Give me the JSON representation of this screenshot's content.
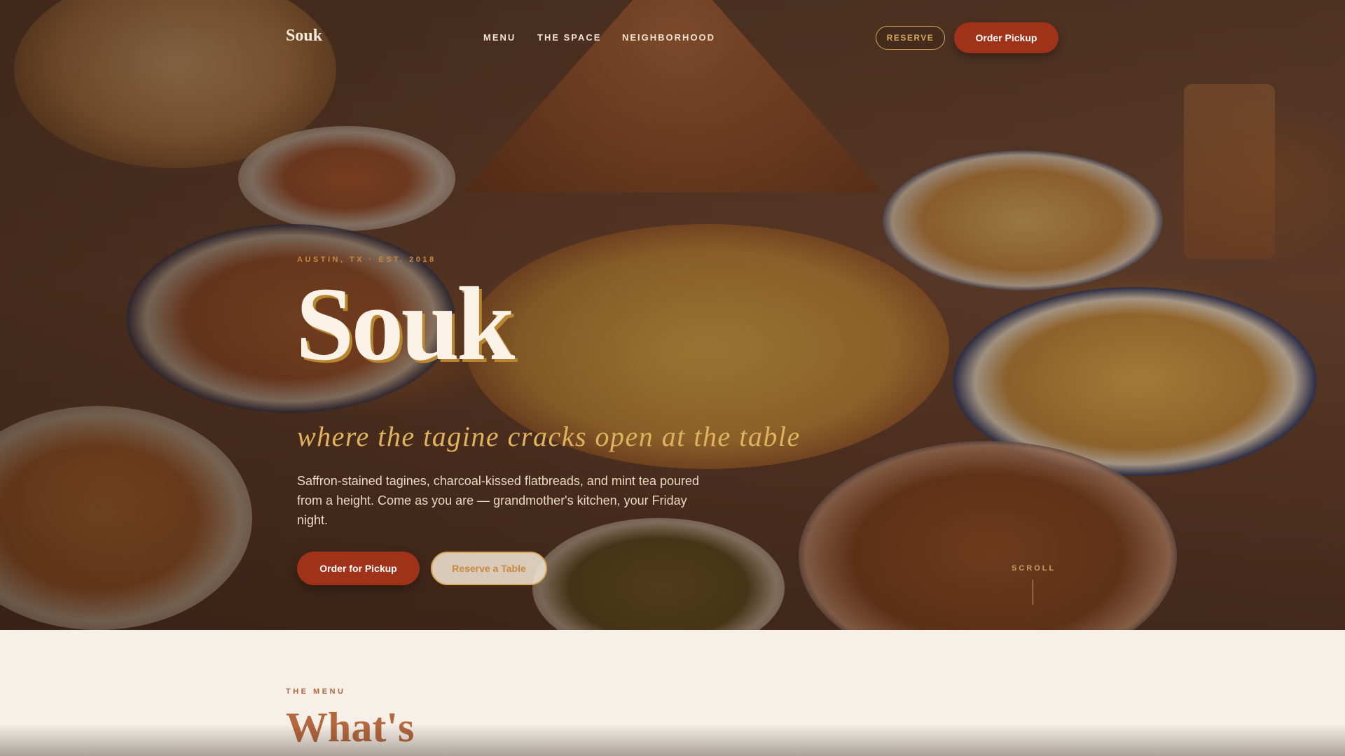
{
  "nav": {
    "logo": "Souk",
    "links": [
      "MENU",
      "THE SPACE",
      "NEIGHBORHOOD"
    ],
    "reserve_label": "RESERVE",
    "order_label": "Order Pickup"
  },
  "hero": {
    "eyebrow": "AUSTIN, TX · EST. 2018",
    "title": "Souk",
    "tagline": "where the tagine cracks open at the table",
    "description": "Saffron-stained tagines, charcoal-kissed flatbreads, and mint tea poured from a height. Come as you are — grandmother's kitchen, your Friday night.",
    "primary_cta": "Order for Pickup",
    "secondary_cta": "Reserve a Table",
    "scroll_label": "SCROLL"
  },
  "menu": {
    "eyebrow": "THE MENU",
    "heading": "What's"
  },
  "colors": {
    "accent_red": "#a1321a",
    "gold": "#d6a45a",
    "terracotta": "#b4683e",
    "cream": "#f6f0e8"
  }
}
